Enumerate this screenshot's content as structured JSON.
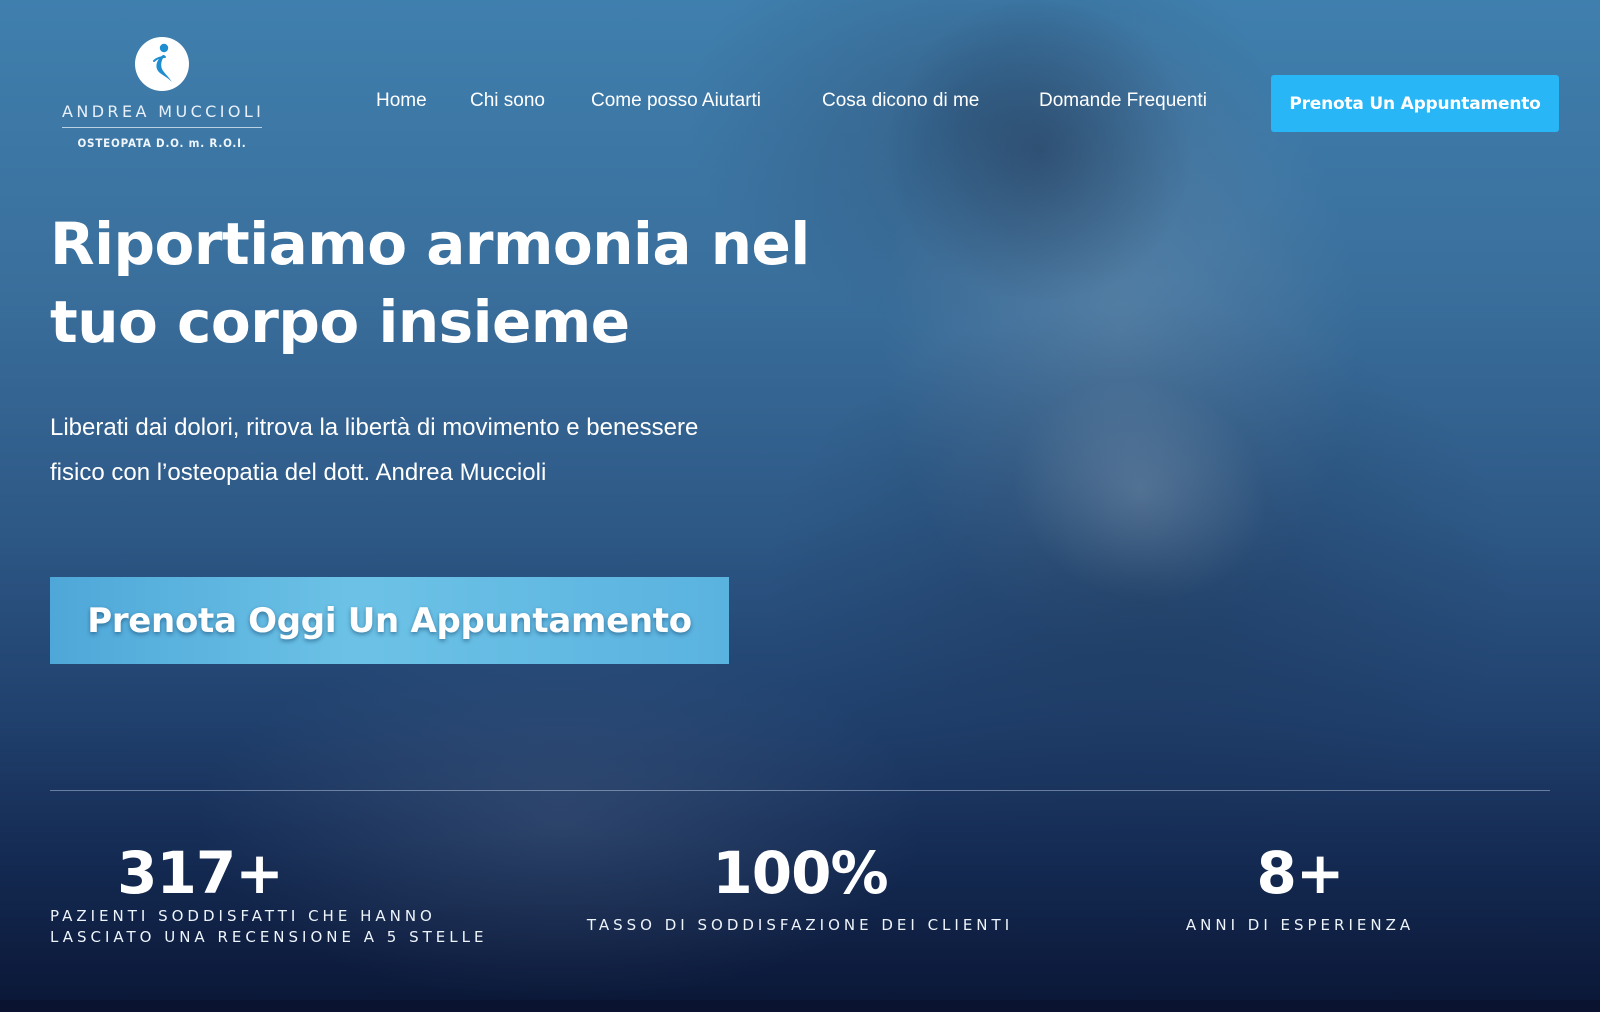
{
  "brand": {
    "name": "ANDREA MUCCIOLI",
    "subtitle": "OSTEOPATA D.O. m. R.O.I.",
    "logo_icon": "figure-in-circle-icon"
  },
  "nav": {
    "items": [
      "Home",
      "Chi sono",
      "Come posso Aiutarti",
      "Cosa dicono di me",
      "Domande Frequenti"
    ],
    "cta": "Prenota Un Appuntamento"
  },
  "hero": {
    "headline_line1": "Riportiamo armonia nel",
    "headline_line2": "tuo corpo insieme",
    "subtext": "Liberati dai dolori, ritrova la libertà di movimento e benessere fisico con l’osteopatia del dott. Andrea Muccioli",
    "cta": "Prenota Oggi Un Appuntamento"
  },
  "stats": [
    {
      "value": "317+",
      "label_line1": "PAZIENTI SODDISFATTI CHE HANNO",
      "label_line2": "LASCIATO UNA RECENSIONE A 5 STELLE"
    },
    {
      "value": "100%",
      "label_line1": "TASSO DI SODDISFAZIONE DEI CLIENTI"
    },
    {
      "value": "8+",
      "label_line1": "ANNI DI ESPERIENZA"
    }
  ],
  "colors": {
    "accent": "#29b6f6",
    "hero_cta_gradient_start": "#4ea7d8",
    "hero_cta_gradient_end": "#6cc2e6",
    "background_dark": "#0b1634"
  }
}
